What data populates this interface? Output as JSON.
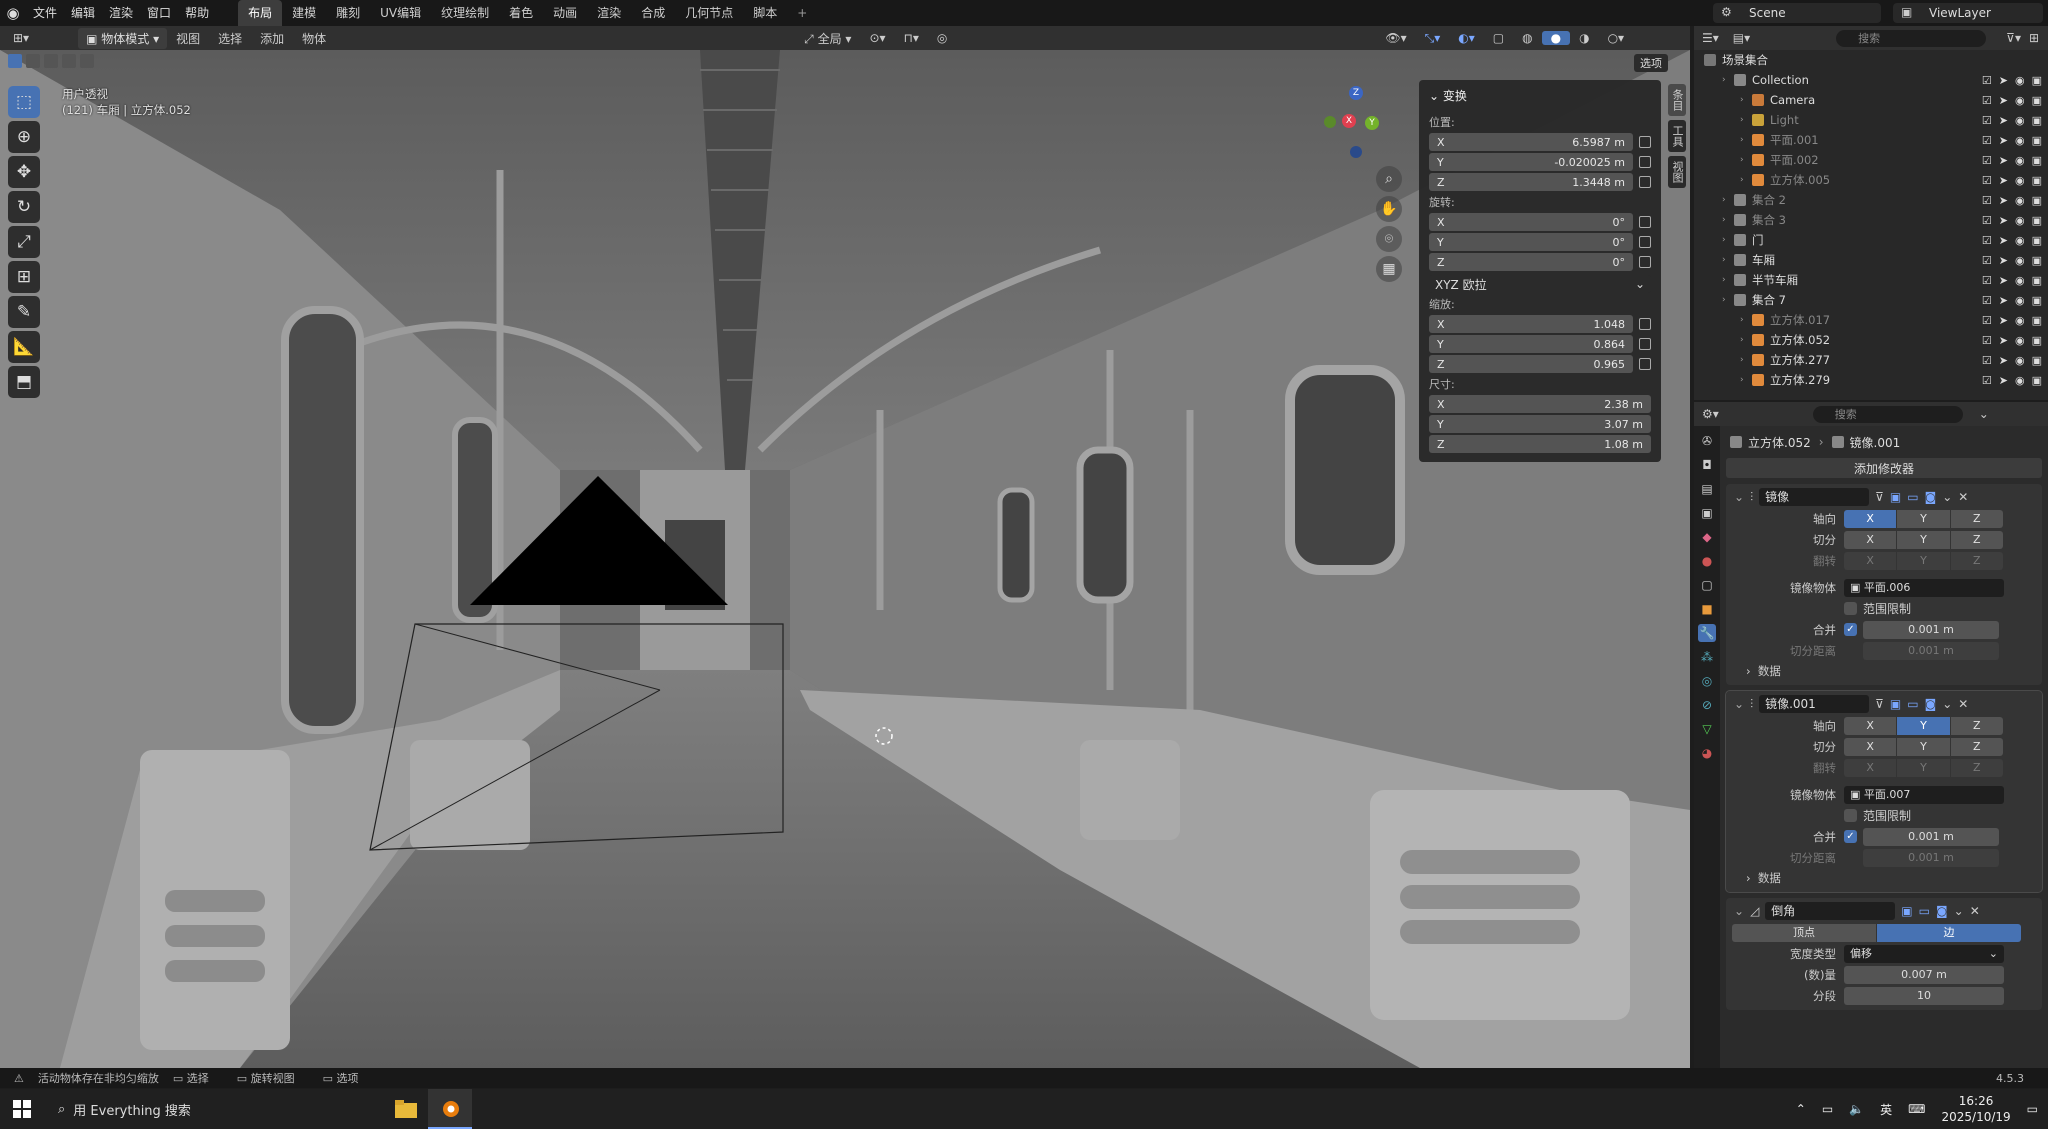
{
  "topbar": {
    "menus": [
      "文件",
      "编辑",
      "渲染",
      "窗口",
      "帮助"
    ],
    "workspaces": [
      "布局",
      "建模",
      "雕刻",
      "UV编辑",
      "纹理绘制",
      "着色",
      "动画",
      "渲染",
      "合成",
      "几何节点",
      "脚本"
    ],
    "active_workspace": "布局",
    "add_tab": "+",
    "scene": "Scene",
    "view_layer": "ViewLayer"
  },
  "viewport_header": {
    "mode": "物体模式",
    "menus": [
      "视图",
      "选择",
      "添加",
      "物体"
    ],
    "transform_orientation": "全局",
    "options": "选项"
  },
  "viewport": {
    "view_name": "用户透视",
    "object_info": "(121) 车厢 | 立方体.052"
  },
  "npanel": {
    "title": "变换",
    "location_label": "位置:",
    "location": [
      {
        "axis": "X",
        "value": "6.5987 m"
      },
      {
        "axis": "Y",
        "value": "-0.020025 m"
      },
      {
        "axis": "Z",
        "value": "1.3448 m"
      }
    ],
    "rotation_label": "旋转:",
    "rotation": [
      {
        "axis": "X",
        "value": "0°"
      },
      {
        "axis": "Y",
        "value": "0°"
      },
      {
        "axis": "Z",
        "value": "0°"
      }
    ],
    "rotation_mode": "XYZ 欧拉",
    "scale_label": "缩放:",
    "scale": [
      {
        "axis": "X",
        "value": "1.048"
      },
      {
        "axis": "Y",
        "value": "0.864"
      },
      {
        "axis": "Z",
        "value": "0.965"
      }
    ],
    "dimensions_label": "尺寸:",
    "dimensions": [
      {
        "axis": "X",
        "value": "2.38 m"
      },
      {
        "axis": "Y",
        "value": "3.07 m"
      },
      {
        "axis": "Z",
        "value": "1.08 m"
      }
    ],
    "side_tabs": [
      "条目",
      "工具",
      "视图"
    ]
  },
  "outliner": {
    "search_placeholder": "搜索",
    "root": "场景集合",
    "rows": [
      {
        "name": "Collection",
        "indent": 1,
        "dim": false
      },
      {
        "name": "Camera",
        "indent": 2,
        "dim": false
      },
      {
        "name": "Light",
        "indent": 2,
        "dim": true
      },
      {
        "name": "平面.001",
        "indent": 2,
        "dim": true
      },
      {
        "name": "平面.002",
        "indent": 2,
        "dim": true
      },
      {
        "name": "立方体.005",
        "indent": 2,
        "dim": true
      },
      {
        "name": "集合 2",
        "indent": 1,
        "dim": true
      },
      {
        "name": "集合 3",
        "indent": 1,
        "dim": true
      },
      {
        "name": "门",
        "indent": 1,
        "dim": false
      },
      {
        "name": "车厢",
        "indent": 1,
        "dim": false
      },
      {
        "name": "半节车厢",
        "indent": 1,
        "dim": false
      },
      {
        "name": "集合 7",
        "indent": 1,
        "dim": false
      },
      {
        "name": "立方体.017",
        "indent": 2,
        "dim": true
      },
      {
        "name": "立方体.052",
        "indent": 2,
        "dim": false
      },
      {
        "name": "立方体.277",
        "indent": 2,
        "dim": false
      },
      {
        "name": "立方体.279",
        "indent": 2,
        "dim": false
      }
    ]
  },
  "properties": {
    "search_placeholder": "搜索",
    "breadcrumb_object": "立方体.052",
    "breadcrumb_modifier": "镜像.001",
    "add_modifier": "添加修改器",
    "mirror1": {
      "name": "镜像",
      "axis_label": "轴向",
      "bisect_label": "切分",
      "flip_label": "翻转",
      "mirror_object_label": "镜像物体",
      "mirror_object": "平面.006",
      "clipping_label": "范围限制",
      "merge_label": "合并",
      "merge_value": "0.001 m",
      "bisect_distance_label": "切分距离",
      "bisect_distance": "0.001 m",
      "data_label": "数据"
    },
    "mirror2": {
      "name": "镜像.001",
      "axis_label": "轴向",
      "bisect_label": "切分",
      "flip_label": "翻转",
      "mirror_object_label": "镜像物体",
      "mirror_object": "平面.007",
      "clipping_label": "范围限制",
      "merge_label": "合并",
      "merge_value": "0.001 m",
      "bisect_distance_label": "切分距离",
      "bisect_distance": "0.001 m",
      "data_label": "数据"
    },
    "bevel": {
      "name": "倒角",
      "vertices": "顶点",
      "edges": "边",
      "width_type_label": "宽度类型",
      "width_type": "偏移",
      "amount_label": "(数)量",
      "amount": "0.007 m",
      "segments_label": "分段",
      "segments": "10"
    },
    "axes": [
      "X",
      "Y",
      "Z"
    ]
  },
  "statusbar": {
    "warning": "活动物体存在非均匀缩放",
    "select": "选择",
    "rotate": "旋转视图",
    "options": "选项",
    "version": "4.5.3"
  },
  "taskbar": {
    "search": "用 Everything 搜索",
    "ime": "英",
    "time": "16:26",
    "date": "2025/10/19"
  }
}
